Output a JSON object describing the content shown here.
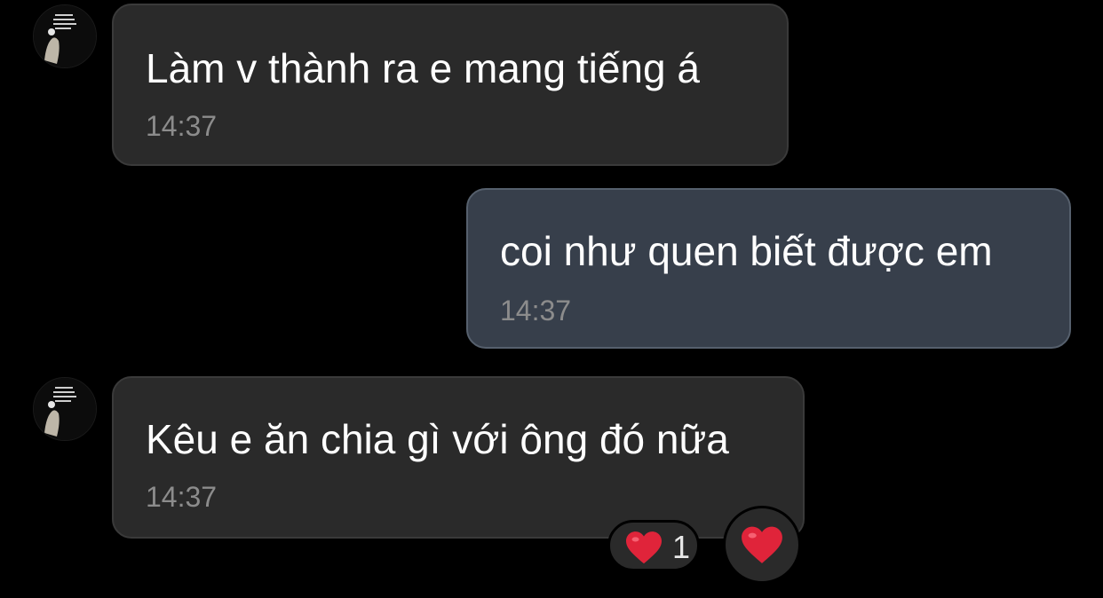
{
  "colors": {
    "background": "#000000",
    "incoming_bubble": "#2a2a2a",
    "outgoing_bubble": "#373f4b",
    "text": "#ffffff",
    "timestamp": "#8c8c8c",
    "heart": "#e0243a"
  },
  "messages": [
    {
      "direction": "incoming",
      "text": "Làm v thành ra e mang tiếng á",
      "time": "14:37"
    },
    {
      "direction": "outgoing",
      "text": "coi như quen biết được em",
      "time": "14:37"
    },
    {
      "direction": "incoming",
      "text": "Kêu e ăn chia gì với ông đó nữa",
      "time": "14:37"
    }
  ],
  "reactions": {
    "summary_icon": "heart-icon",
    "count": "1",
    "react_button_icon": "heart-icon"
  }
}
